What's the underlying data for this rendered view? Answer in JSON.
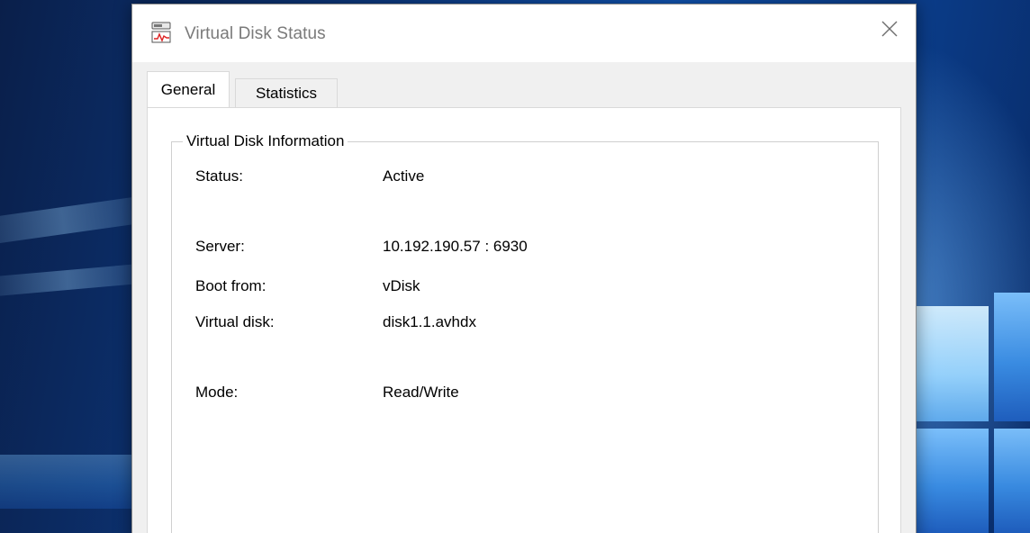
{
  "window": {
    "title": "Virtual Disk Status",
    "app_icon": "virtual-disk-monitor-icon",
    "close_icon": "close-icon"
  },
  "tabs": [
    {
      "label": "General",
      "active": true
    },
    {
      "label": "Statistics",
      "active": false
    }
  ],
  "group": {
    "title": "Virtual Disk Information",
    "rows": [
      {
        "label": "Status:",
        "value": "Active"
      },
      {
        "label": "Server:",
        "value": "10.192.190.57 : 6930"
      },
      {
        "label": "Boot from:",
        "value": "vDisk"
      },
      {
        "label": "Virtual disk:",
        "value": "disk1.1.avhdx"
      },
      {
        "label": "Mode:",
        "value": "Read/Write"
      }
    ]
  },
  "colors": {
    "desktop": "#0d3c86",
    "dialog_bg": "#f0f0f0",
    "panel_bg": "#ffffff",
    "title_text": "#7a7a7a"
  }
}
